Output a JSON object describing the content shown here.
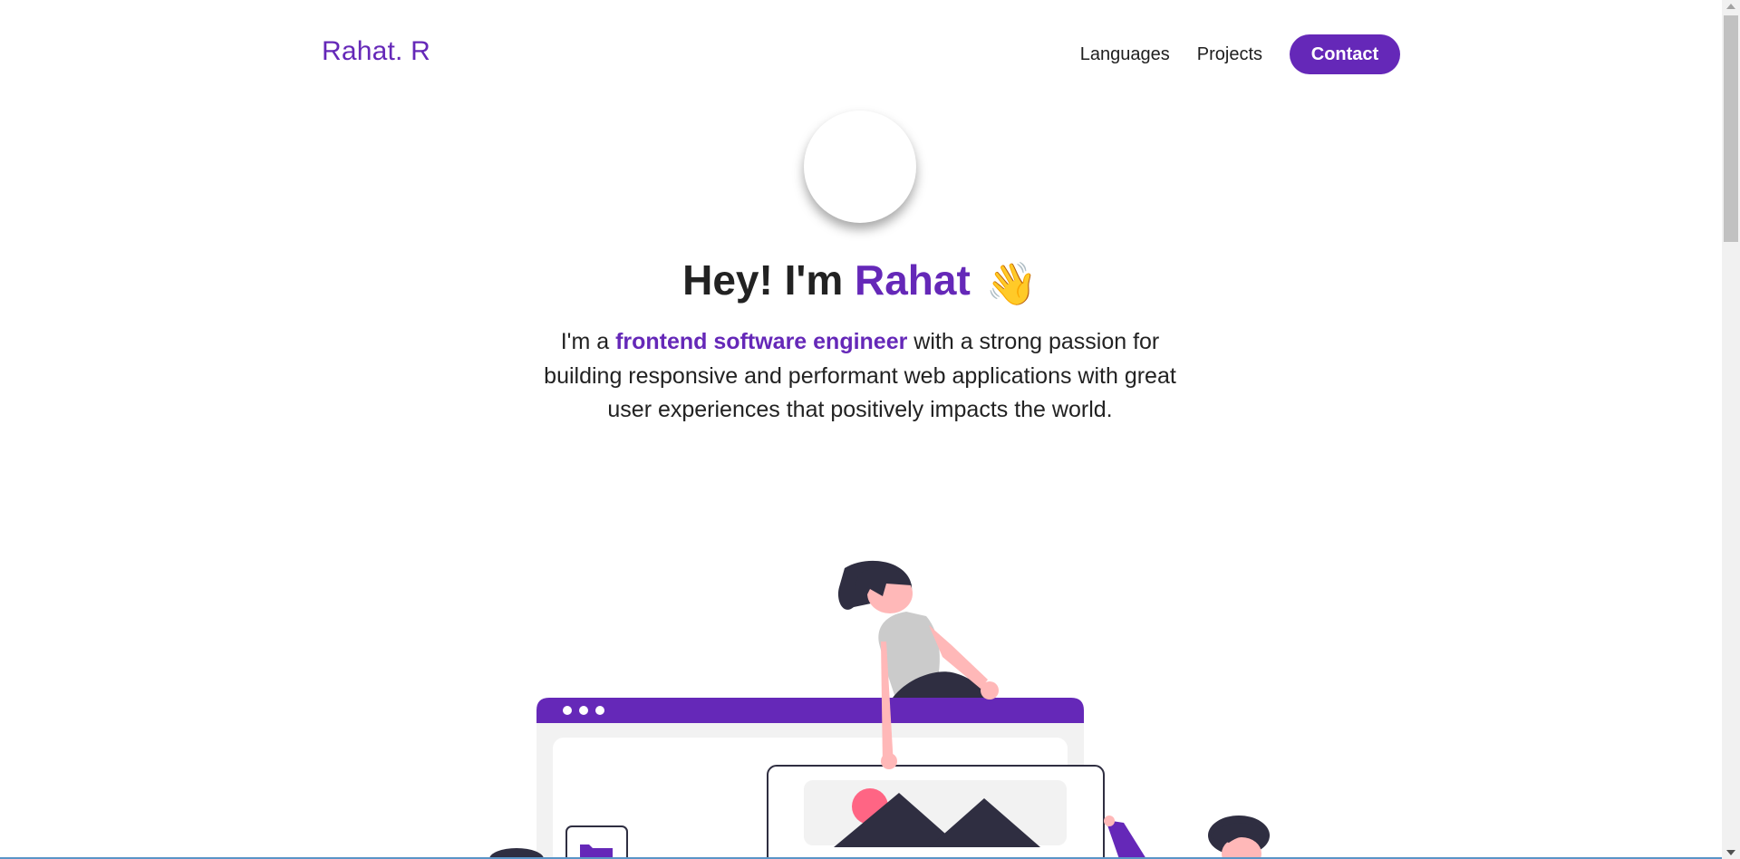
{
  "nav": {
    "logo": "Rahat. R",
    "links": [
      {
        "label": "Languages"
      },
      {
        "label": "Projects"
      }
    ],
    "contact_label": "Contact"
  },
  "hero": {
    "greeting": "Hey! I'm ",
    "name": "Rahat",
    "wave_emoji": "👋",
    "desc_prefix": "I'm a ",
    "desc_highlight": "frontend software engineer",
    "desc_suffix": " with a strong passion for building responsive and performant web applications with great user experiences that positively impacts the world."
  },
  "colors": {
    "accent": "#6528b8",
    "text": "#222222",
    "illustration_dark": "#2f2e41",
    "illustration_skin": "#ffb8b8",
    "illustration_pink": "#ff6584",
    "illustration_grey": "#f2f2f2"
  },
  "icons": [
    "wave-emoji",
    "folder-icon",
    "image-icon"
  ]
}
